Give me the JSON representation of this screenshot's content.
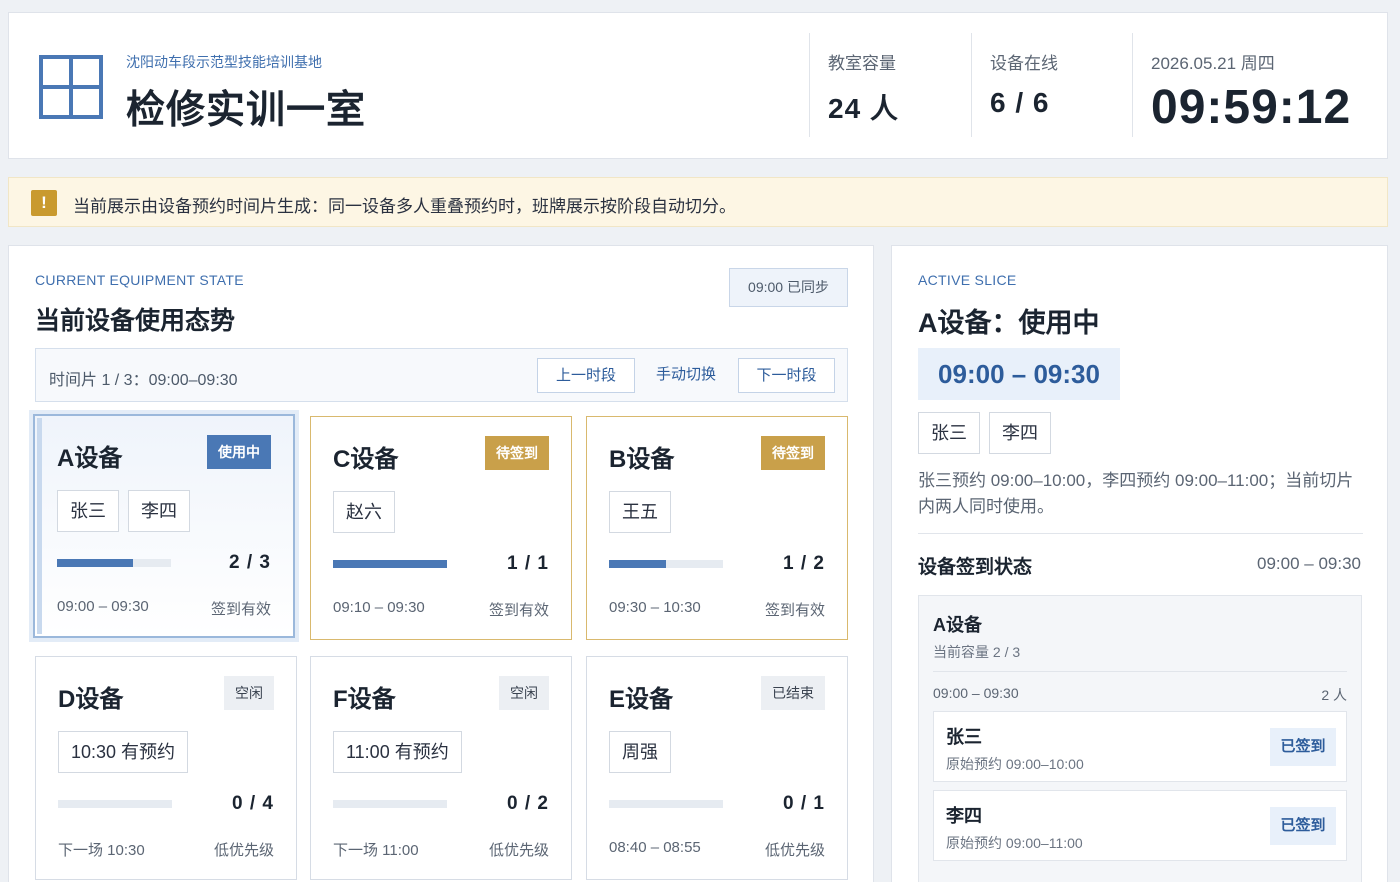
{
  "header": {
    "base_name": "沈阳动车段示范型技能培训基地",
    "room_name": "检修实训一室",
    "capacity_label": "教室容量",
    "capacity_value": "24 人",
    "online_label": "设备在线",
    "online_value": "6 / 6",
    "date": "2026.05.21 周四",
    "clock": "09:59:12"
  },
  "notice": {
    "icon": "!",
    "text": "当前展示由设备预约时间片生成：同一设备多人重叠预约时，班牌展示按阶段自动切分。"
  },
  "left_panel": {
    "eyebrow": "CURRENT EQUIPMENT STATE",
    "title": "当前设备使用态势",
    "sync_badge": "09:00 已同步",
    "slice_label": "时间片 1 / 3：09:00–09:30",
    "prev_label": "上一时段",
    "manual_label": "手动切换",
    "next_label": "下一时段",
    "cards": [
      {
        "name": "A设备",
        "status": "使用中",
        "chips": [
          "张三",
          "李四"
        ],
        "count": "2 / 3",
        "progress": 0.667,
        "time": "09:00 – 09:30",
        "note": "签到有效"
      },
      {
        "name": "C设备",
        "status": "待签到",
        "chips": [
          "赵六"
        ],
        "count": "1 / 1",
        "progress": 1.0,
        "time": "09:10 – 09:30",
        "note": "签到有效"
      },
      {
        "name": "B设备",
        "status": "待签到",
        "chips": [
          "王五"
        ],
        "count": "1 / 2",
        "progress": 0.5,
        "time": "09:30 – 10:30",
        "note": "签到有效"
      },
      {
        "name": "D设备",
        "status": "空闲",
        "chips": [
          "10:30 有预约"
        ],
        "count": "0 / 4",
        "progress": 0,
        "time": "下一场 10:30",
        "note": "低优先级"
      },
      {
        "name": "F设备",
        "status": "空闲",
        "chips": [
          "11:00 有预约"
        ],
        "count": "0 / 2",
        "progress": 0,
        "time": "下一场 11:00",
        "note": "低优先级"
      },
      {
        "name": "E设备",
        "status": "已结束",
        "chips": [
          "周强"
        ],
        "count": "0 / 1",
        "progress": 0,
        "time": "08:40 – 08:55",
        "note": "低优先级"
      }
    ]
  },
  "right_panel": {
    "eyebrow": "ACTIVE SLICE",
    "title": "A设备：使用中",
    "time_range": "09:00 – 09:30",
    "chips": [
      "张三",
      "李四"
    ],
    "description": "张三预约 09:00–10:00，李四预约 09:00–11:00；当前切片内两人同时使用。",
    "section_title": "设备签到状态",
    "section_time": "09:00 – 09:30",
    "signin": {
      "device": "A设备",
      "capacity": "当前容量 2 / 3",
      "slice_time": "09:00 – 09:30",
      "slice_count": "2 人",
      "people": [
        {
          "name": "张三",
          "note": "原始预约 09:00–10:00",
          "status": "已签到"
        },
        {
          "name": "李四",
          "note": "原始预约 09:00–11:00",
          "status": "已签到"
        }
      ]
    }
  },
  "colors": {
    "accent": "#4a78b5",
    "pending": "#c9a04a",
    "notice_bg": "#fdf6e4"
  }
}
